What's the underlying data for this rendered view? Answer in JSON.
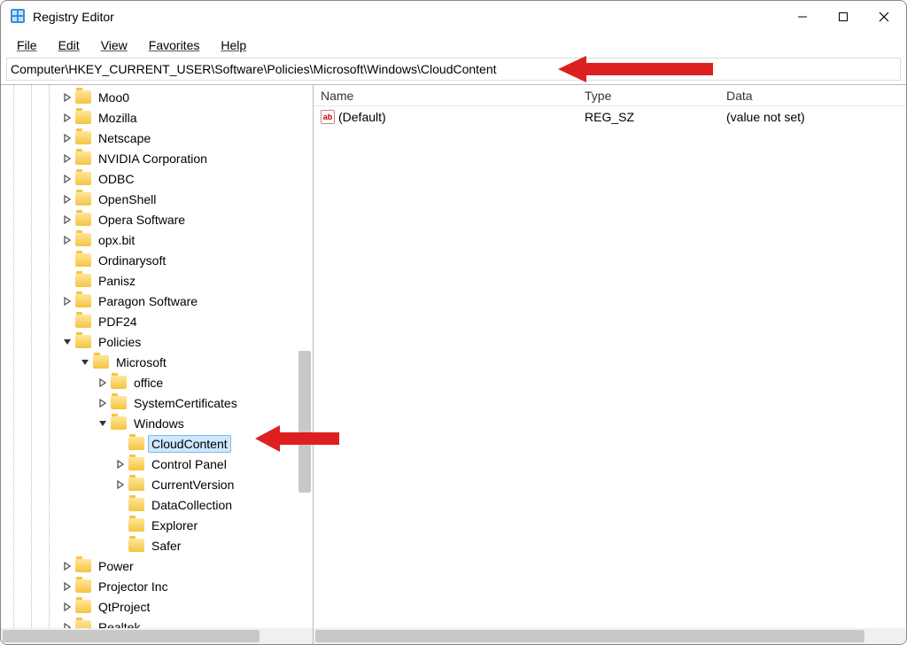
{
  "window": {
    "title": "Registry Editor"
  },
  "menubar": {
    "file": "File",
    "edit": "Edit",
    "view": "View",
    "favorites": "Favorites",
    "help": "Help"
  },
  "addressbar": {
    "path": "Computer\\HKEY_CURRENT_USER\\Software\\Policies\\Microsoft\\Windows\\CloudContent"
  },
  "columns": {
    "name": "Name",
    "type": "Type",
    "data": "Data"
  },
  "values": [
    {
      "name": "(Default)",
      "type": "REG_SZ",
      "data": "(value not set)"
    }
  ],
  "tree": [
    {
      "depth": 3,
      "caret": "right",
      "label": "Moo0"
    },
    {
      "depth": 3,
      "caret": "right",
      "label": "Mozilla"
    },
    {
      "depth": 3,
      "caret": "right",
      "label": "Netscape"
    },
    {
      "depth": 3,
      "caret": "right",
      "label": "NVIDIA Corporation"
    },
    {
      "depth": 3,
      "caret": "right",
      "label": "ODBC"
    },
    {
      "depth": 3,
      "caret": "right",
      "label": "OpenShell"
    },
    {
      "depth": 3,
      "caret": "right",
      "label": "Opera Software"
    },
    {
      "depth": 3,
      "caret": "right",
      "label": "opx.bit"
    },
    {
      "depth": 3,
      "caret": "none",
      "label": "Ordinarysoft"
    },
    {
      "depth": 3,
      "caret": "none",
      "label": "Panisz"
    },
    {
      "depth": 3,
      "caret": "right",
      "label": "Paragon Software"
    },
    {
      "depth": 3,
      "caret": "none",
      "label": "PDF24"
    },
    {
      "depth": 3,
      "caret": "down",
      "label": "Policies"
    },
    {
      "depth": 4,
      "caret": "down",
      "label": "Microsoft"
    },
    {
      "depth": 5,
      "caret": "right",
      "label": "office"
    },
    {
      "depth": 5,
      "caret": "right",
      "label": "SystemCertificates"
    },
    {
      "depth": 5,
      "caret": "down",
      "label": "Windows"
    },
    {
      "depth": 6,
      "caret": "none",
      "label": "CloudContent",
      "selected": true
    },
    {
      "depth": 6,
      "caret": "right",
      "label": "Control Panel"
    },
    {
      "depth": 6,
      "caret": "right",
      "label": "CurrentVersion"
    },
    {
      "depth": 6,
      "caret": "none",
      "label": "DataCollection"
    },
    {
      "depth": 6,
      "caret": "none",
      "label": "Explorer"
    },
    {
      "depth": 6,
      "caret": "none",
      "label": "Safer"
    },
    {
      "depth": 3,
      "caret": "right",
      "label": "Power"
    },
    {
      "depth": 3,
      "caret": "right",
      "label": "Projector Inc"
    },
    {
      "depth": 3,
      "caret": "right",
      "label": "QtProject"
    },
    {
      "depth": 3,
      "caret": "right",
      "label": "Realtek"
    }
  ]
}
